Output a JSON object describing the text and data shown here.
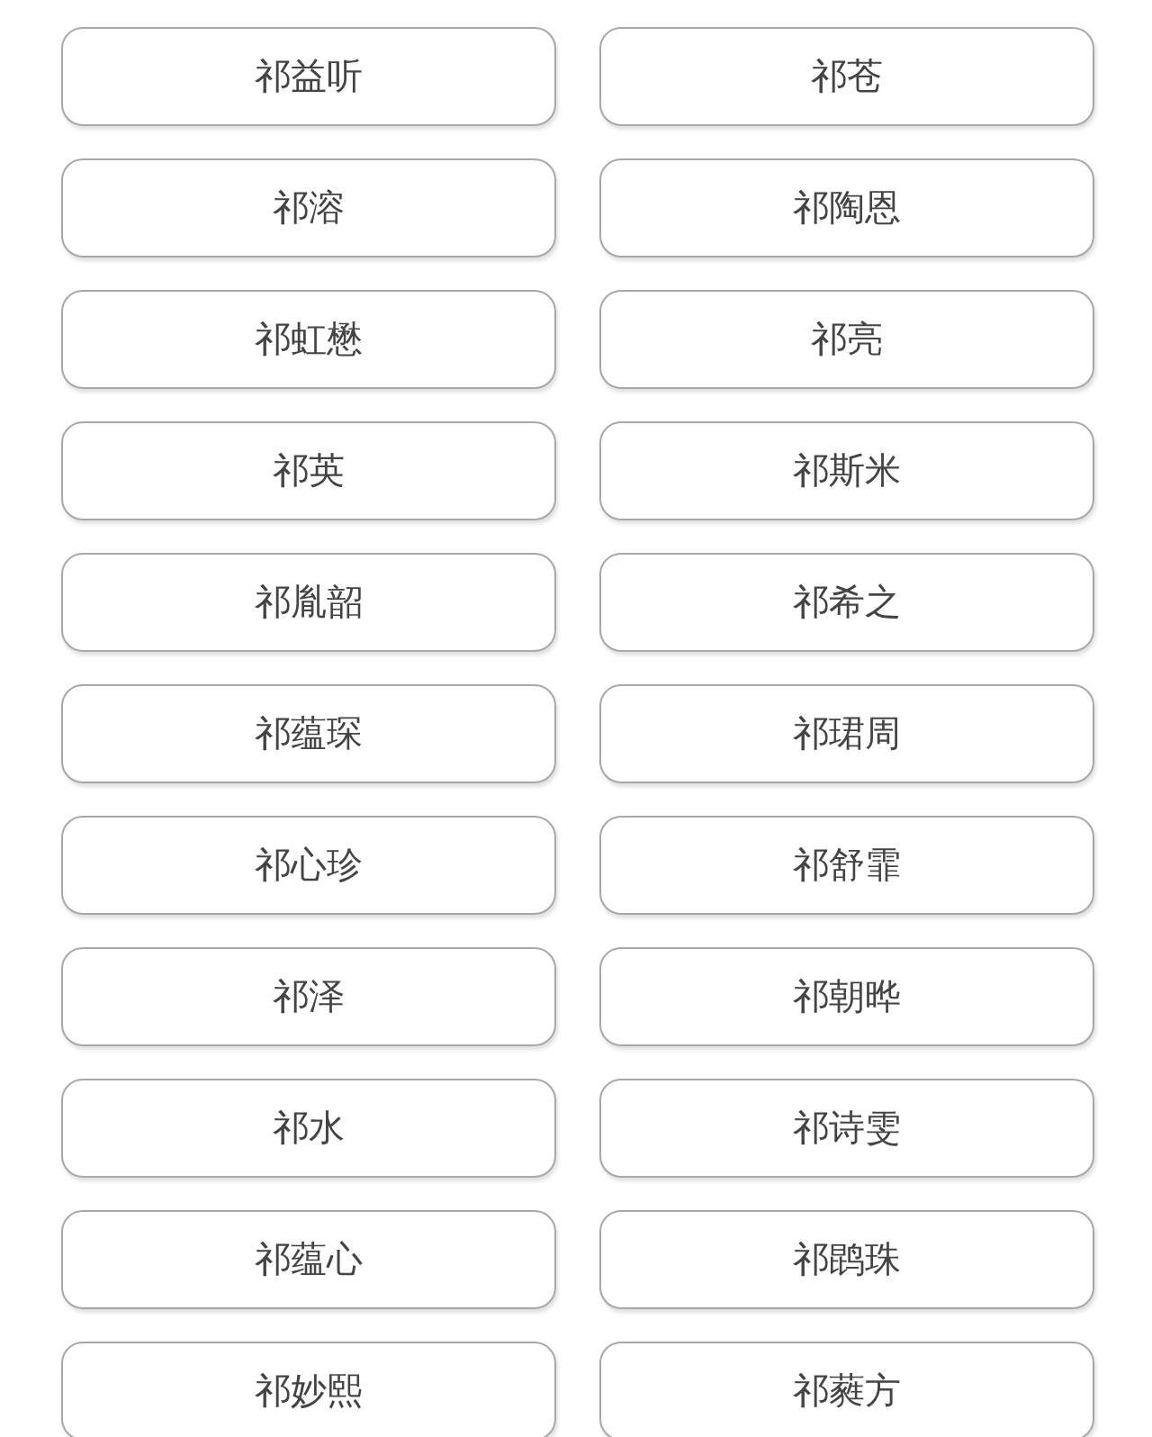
{
  "names": [
    {
      "label": "祁益听"
    },
    {
      "label": "祁苍"
    },
    {
      "label": "祁溶"
    },
    {
      "label": "祁陶恩"
    },
    {
      "label": "祁虹懋"
    },
    {
      "label": "祁亮"
    },
    {
      "label": "祁英"
    },
    {
      "label": "祁斯米"
    },
    {
      "label": "祁胤韶"
    },
    {
      "label": "祁希之"
    },
    {
      "label": "祁蕴琛"
    },
    {
      "label": "祁珺周"
    },
    {
      "label": "祁心珍"
    },
    {
      "label": "祁舒霏"
    },
    {
      "label": "祁泽"
    },
    {
      "label": "祁朝晔"
    },
    {
      "label": "祁水"
    },
    {
      "label": "祁诗雯"
    },
    {
      "label": "祁蕴心"
    },
    {
      "label": "祁鹍珠"
    },
    {
      "label": "祁妙熙"
    },
    {
      "label": "祁蕤方"
    }
  ]
}
